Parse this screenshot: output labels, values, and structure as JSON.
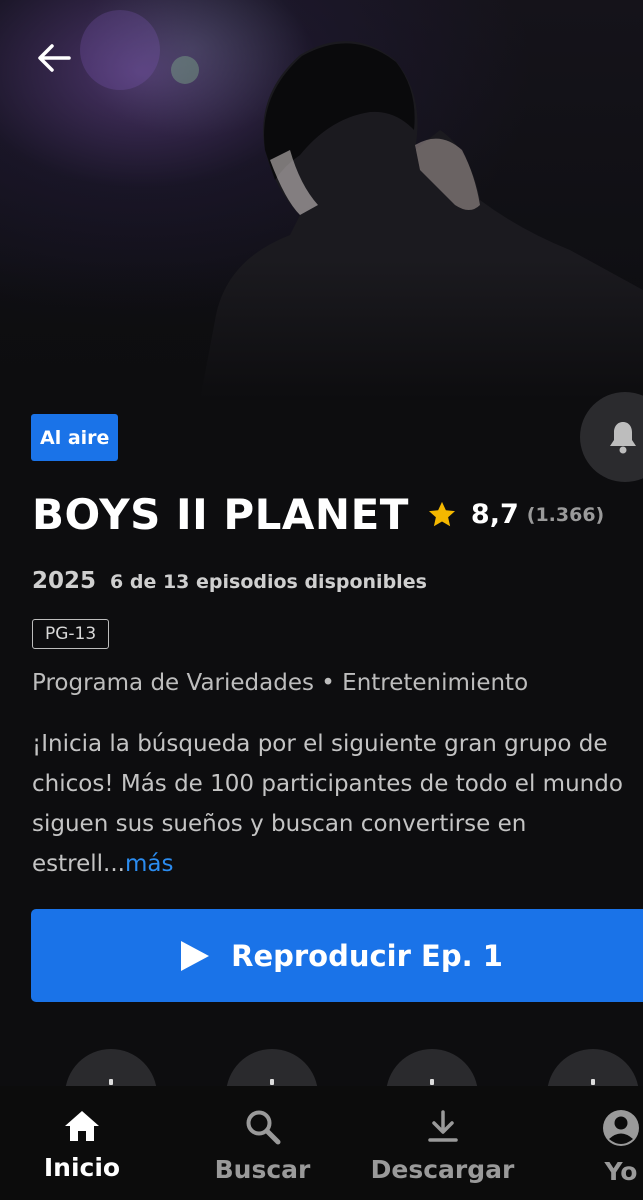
{
  "header": {
    "back_icon": "arrow-left-icon"
  },
  "show": {
    "status_badge": "Al aire",
    "title": "BOYS II PLANET",
    "rating": "8,7",
    "votes": "(1.366)",
    "year": "2025",
    "episodes_available": "6 de 13 episodios disponibles",
    "content_rating": "PG-13",
    "genres": "Programa de Variedades • Entretenimiento",
    "description": "¡Inicia la búsqueda por el siguiente gran grupo de chicos! Más de 100 participantes de todo el mundo siguen sus sueños y buscan convertirse en estrell...",
    "more_link": "más"
  },
  "actions": {
    "play_label": "Reproducir Ep. 1",
    "notify_icon": "bell-icon"
  },
  "nav": {
    "items": [
      {
        "label": "Inicio",
        "icon": "home-icon",
        "active": true
      },
      {
        "label": "Buscar",
        "icon": "search-icon",
        "active": false
      },
      {
        "label": "Descargar",
        "icon": "download-icon",
        "active": false
      },
      {
        "label": "Yo",
        "icon": "profile-icon",
        "active": false
      }
    ]
  },
  "colors": {
    "accent": "#1a73e8",
    "star": "#f5b800",
    "link": "#2b8cf0",
    "background": "#0d0d0f"
  }
}
